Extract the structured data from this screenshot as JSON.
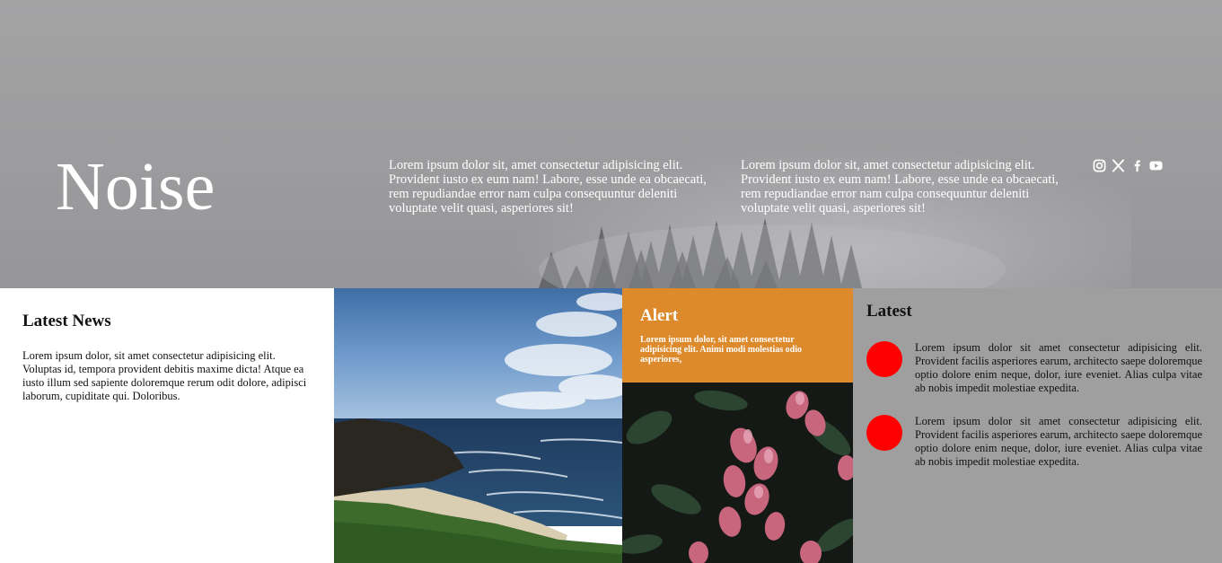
{
  "hero": {
    "brand": "Noise",
    "text_1": "Lorem ipsum dolor sit, amet consectetur adipisicing elit. Provident iusto ex eum nam! Labore, esse unde ea obcaecati, rem repudiandae error nam culpa consequuntur deleniti voluptate velit quasi, asperiores sit!",
    "text_2": "Lorem ipsum dolor sit, amet consectetur adipisicing elit. Provident iusto ex eum nam! Labore, esse unde ea obcaecati, rem repudiandae error nam culpa consequuntur deleniti voluptate velit quasi, asperiores sit!",
    "social_icons": [
      "instagram-icon",
      "x-icon",
      "facebook-icon",
      "youtube-icon"
    ]
  },
  "news": {
    "title": "Latest News",
    "body": "Lorem ipsum dolor, sit amet consectetur adipisicing elit. Voluptas id, tempora provident debitis maxime dicta! Atque ea iusto illum sed sapiente doloremque rerum odit dolore, adipisci laborum, cupiditate qui. Doloribus."
  },
  "alert": {
    "title": "Alert",
    "body": "Lorem ipsum dolor, sit amet consectetur adipisicing elit. Animi modi molestias odio asperiores,"
  },
  "latest": {
    "title": "Latest",
    "items": [
      {
        "text": "Lorem ipsum dolor sit amet consectetur adipisicing elit. Provident facilis asperiores earum, architecto saepe doloremque optio dolore enim neque, dolor, iure eveniet. Alias culpa vitae ab nobis impedit molestiae expedita."
      },
      {
        "text": "Lorem ipsum dolor sit amet consectetur adipisicing elit. Provident facilis asperiores earum, architecto saepe doloremque optio dolore enim neque, dolor, iure eveniet. Alias culpa vitae ab nobis impedit molestiae expedita."
      }
    ]
  },
  "colors": {
    "alert_bg": "#dc8a2c",
    "latest_bg": "#a09f9f",
    "dot": "#ff0000"
  }
}
